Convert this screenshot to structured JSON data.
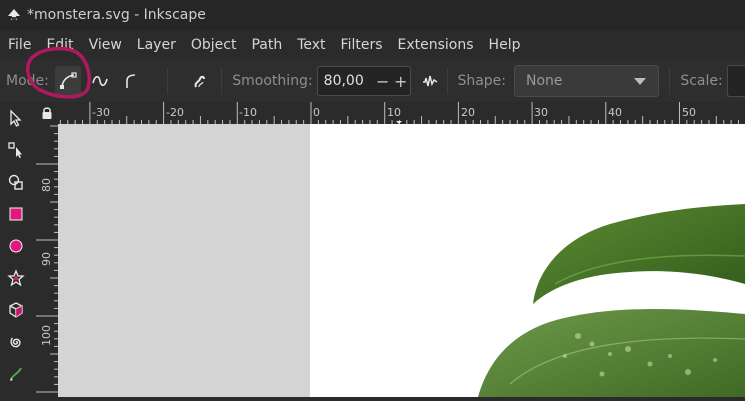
{
  "window": {
    "title": "*monstera.svg - Inkscape",
    "app_icon": "inkscape-logo-icon"
  },
  "menu": [
    "File",
    "Edit",
    "View",
    "Layer",
    "Object",
    "Path",
    "Text",
    "Filters",
    "Extensions",
    "Help"
  ],
  "tool_controls": {
    "mode_label": "Mode:",
    "modes": [
      {
        "icon": "bezier-mode-icon",
        "active": true
      },
      {
        "icon": "spiro-mode-icon",
        "active": false
      },
      {
        "icon": "bspline-mode-icon",
        "active": false
      }
    ],
    "pressure_icon": "pressure-icon",
    "smoothing_label": "Smoothing:",
    "smoothing_value": "80,00",
    "minus_label": "−",
    "plus_label": "+",
    "lpe_icon": "lpe-icon",
    "shape_label": "Shape:",
    "shape_value": "None",
    "scale_label": "Scale:"
  },
  "toolbox": [
    "selector-icon",
    "node-editor-icon",
    "tweak-icon",
    "rectangle-icon",
    "ellipse-icon",
    "star-icon",
    "box-3d-icon",
    "spiral-icon",
    "pencil-icon"
  ],
  "ruler": {
    "horizontal_labels": [
      "-30",
      "-20",
      "-10",
      "0",
      "10",
      "20",
      "30",
      "40",
      "50"
    ],
    "vertical_labels": [
      "80",
      "90",
      "100"
    ]
  },
  "colors": {
    "accent_annotation": "#b0185f",
    "rectangle_tool": "#e0197a",
    "leaf_green": "#4d7a2a"
  }
}
